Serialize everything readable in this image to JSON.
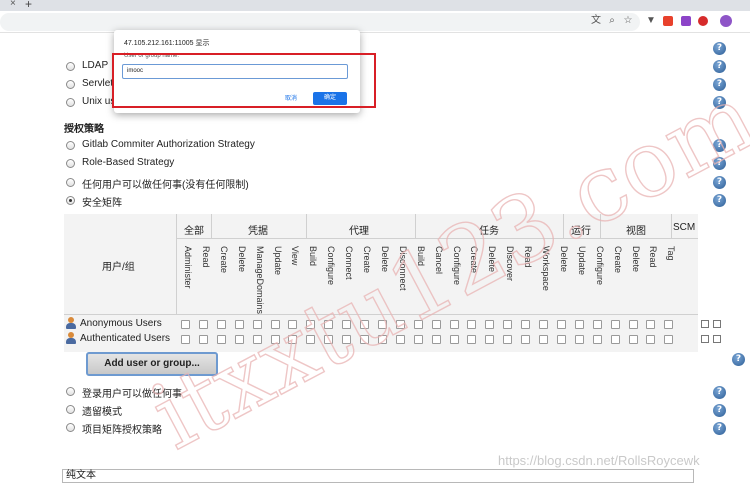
{
  "browser": {
    "tab_close_glyph": "×",
    "new_tab_glyph": "+",
    "toolbar_icons": [
      "translate-icon",
      "zoom-icon",
      "bookmark-star-icon",
      "extension-icon",
      "extension-icon",
      "extension-icon",
      "profile-icon"
    ],
    "ext_colors": [
      "#e8412c",
      "#8c44c8",
      "#d62b2b"
    ]
  },
  "auth_realm": {
    "options": [
      {
        "label": "LDAP"
      },
      {
        "label": "Servlet"
      },
      {
        "label": "Unix us"
      }
    ]
  },
  "authorization": {
    "title": "授权策略",
    "options": [
      {
        "label": "Gitlab Commiter Authorization Strategy",
        "checked": false
      },
      {
        "label": "Role-Based Strategy",
        "checked": false
      },
      {
        "label": "任何用户可以做任何事(没有任何限制)",
        "checked": false
      },
      {
        "label": "安全矩阵",
        "checked": true
      }
    ],
    "options_after": [
      {
        "label": "登录用户可以做任何事"
      },
      {
        "label": "遗留模式"
      },
      {
        "label": "项目矩阵授权策略"
      }
    ]
  },
  "matrix": {
    "user_group_header": "用户/组",
    "groups": [
      "全部",
      "凭据",
      "代理",
      "任务",
      "运行",
      "视图",
      "SCM"
    ],
    "permissions": [
      "Administer",
      "Read",
      "Create",
      "Delete",
      "ManageDomains",
      "Update",
      "View",
      "Build",
      "Configure",
      "Connect",
      "Create",
      "Delete",
      "Disconnect",
      "Build",
      "Cancel",
      "Configure",
      "Create",
      "Delete",
      "Discover",
      "Read",
      "Workspace",
      "Delete",
      "Update",
      "Configure",
      "Create",
      "Delete",
      "Read",
      "Tag"
    ],
    "rows": [
      {
        "name": "Anonymous Users"
      },
      {
        "name": "Authenticated Users"
      }
    ],
    "add_button_label": "Add user or group..."
  },
  "dialog": {
    "title": "47.105.212.161:11005 显示",
    "label": "User or group name:",
    "input_value": "imooc",
    "cancel_label": "取消",
    "ok_label": "确定"
  },
  "bottom_select": {
    "value": "纯文本"
  },
  "footer_url": "https://blog.csdn.net/RollsRoycewk",
  "watermark": "itxxtu123.com",
  "colors": {
    "highlight": "#d81f26",
    "help_icon": "#2c5d95",
    "primary": "#1a73e8"
  }
}
